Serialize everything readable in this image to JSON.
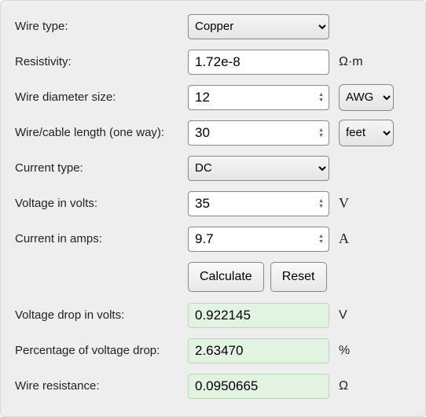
{
  "labels": {
    "wire_type": "Wire type:",
    "resistivity": "Resistivity:",
    "diameter": "Wire diameter size:",
    "length": "Wire/cable length (one way):",
    "current_type": "Current type:",
    "voltage": "Voltage in volts:",
    "current": "Current in amps:",
    "vdrop": "Voltage drop in volts:",
    "vdrop_pct": "Percentage of voltage drop:",
    "wire_res": "Wire resistance:"
  },
  "values": {
    "wire_type": "Copper",
    "resistivity": "1.72e-8",
    "diameter": "12",
    "diameter_unit": "AWG",
    "length": "30",
    "length_unit": "feet",
    "current_type": "DC",
    "voltage": "35",
    "current": "9.7",
    "vdrop": "0.922145",
    "vdrop_pct": "2.63470",
    "wire_res": "0.0950665"
  },
  "units": {
    "resistivity": "Ω·m",
    "voltage": "V",
    "current": "A",
    "vdrop": "V",
    "vdrop_pct": "%",
    "wire_res": "Ω"
  },
  "buttons": {
    "calculate": "Calculate",
    "reset": "Reset"
  }
}
